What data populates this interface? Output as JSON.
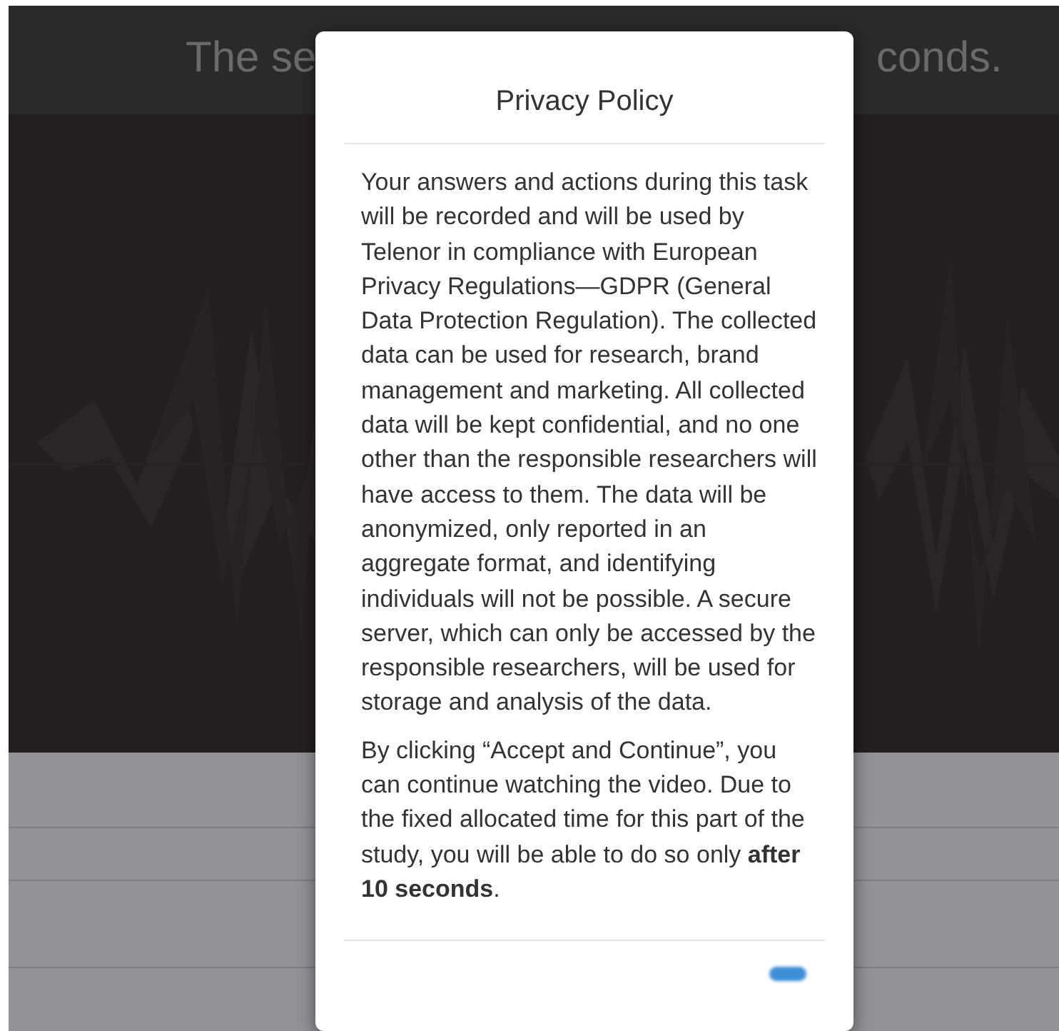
{
  "background": {
    "header_text_left": "The se",
    "header_text_right": "conds."
  },
  "modal": {
    "title": "Privacy Policy",
    "paragraphs": [
      "Your answers and actions during this task will be recorded and will be used by Telenor in compliance with European Privacy Regulations—GDPR (General Data Protection Regulation). The collected data can be used for research, brand management and marketing. All collected data will be kept confidential, and no one other than the responsible researchers will have access to them. The data will be anonymized, only reported in an aggregate format, and identifying individuals will not be possible. A secure server, which can only be accessed by the responsible researchers, will be used for storage and analysis of the data.",
      "By clicking “Accept and Continue”, you can continue watching the video. Due to the fixed allocated time for this part of the study, you will be able to do so only **after 10 seconds**."
    ]
  }
}
